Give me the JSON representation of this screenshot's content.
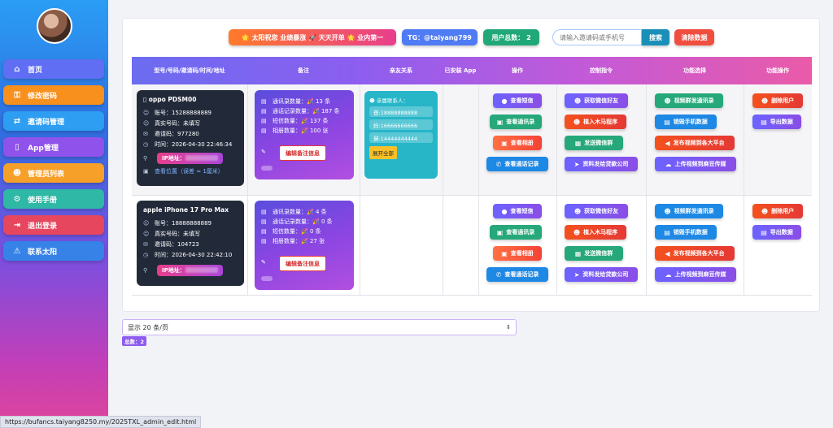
{
  "sidebar": {
    "items": [
      {
        "label": "首页",
        "icon": "home-icon",
        "color": "#5a6cf0"
      },
      {
        "label": "修改密码",
        "icon": "key-icon",
        "color": "#f58c1e"
      },
      {
        "label": "邀请码管理",
        "icon": "shuffle-icon",
        "color": "#2a9df4"
      },
      {
        "label": "App管理",
        "icon": "mobile-icon",
        "color": "#8a4ee6"
      },
      {
        "label": "管理员列表",
        "icon": "users-icon",
        "color": "#f59a24"
      },
      {
        "label": "使用手册",
        "icon": "gears-icon",
        "color": "#2fb5a5"
      },
      {
        "label": "退出登录",
        "icon": "logout-icon",
        "color": "#e0445c"
      },
      {
        "label": "联系太阳",
        "icon": "warning-icon",
        "color": "#2d7fe0"
      }
    ]
  },
  "topbar": {
    "banner": "🌟 太阳祝您 业绩暴涨 🚀 天天开单 🌟 业内第一",
    "tg": "TG：@taiyang799",
    "users_total": "用户总数： 2",
    "search_placeholder": "请输入邀请码或手机号",
    "search_label": "搜索",
    "clear_label": "清除数据"
  },
  "table": {
    "headers": [
      "型号/号码/邀请码/时间/地址",
      "备注",
      "亲友关系",
      "已安装 App",
      "操作",
      "控制指令",
      "功能选择",
      "功能操作"
    ]
  },
  "rows": [
    {
      "device": {
        "model": "oppo PDSM00",
        "account": "账号：15288888889",
        "realname": "真实号码：未填写",
        "invite": "邀请码：977280",
        "time": "时间：2026-04-30 22:46:34",
        "ip_label": "IP地址：",
        "location": "查看位置（误差 ≈ 1厘米）"
      },
      "note": {
        "sms": "通讯录数量：🎉 13 条",
        "calls": "通话记录数量：🎉 187 条",
        "msgs": "短信数量：🎉 137 条",
        "photos": "相册数量：🎉 100 张",
        "edit": "编辑备注信息"
      }
    },
    {
      "device": {
        "model": "apple iPhone 17 Pro Max",
        "account": "账号：18888888889",
        "realname": "真实号码：未填写",
        "invite": "邀请码：104723",
        "time": "时间：2026-04-30 22:42:10",
        "ip_label": "IP地址："
      },
      "note": {
        "sms": "通讯录数量：🎉 4 条",
        "calls": "通话记录数量：🎉 0 条",
        "msgs": "短信数量：🎉 0 条",
        "photos": "相册数量：🎉 27 张",
        "edit": "编辑备注信息"
      }
    }
  ],
  "contacts": {
    "title": "亲属联系人：",
    "list": [
      "爸:18888888888",
      "妈:16666666666",
      "舅:14444444444"
    ],
    "expand": "展开全部"
  },
  "actions": {
    "ops": [
      "查看短信",
      "查看通讯录",
      "查看相册",
      "查看通话记录"
    ],
    "ctrl": [
      "获取微信好友",
      "植入木马程序",
      "发送微信群",
      "资料发给贷款公司"
    ],
    "func": [
      "视频群发通讯录",
      "销毁手机数据",
      "发布视频到各大平台",
      "上传视频到麻豆传媒"
    ],
    "manage": [
      "删除用户",
      "导出数据"
    ]
  },
  "footer": {
    "page_size": "显示 20 条/页",
    "total": "总数：2",
    "status_url": "https://bufancs.taiyang8250.my/2025TXL_admin_edit.html"
  }
}
